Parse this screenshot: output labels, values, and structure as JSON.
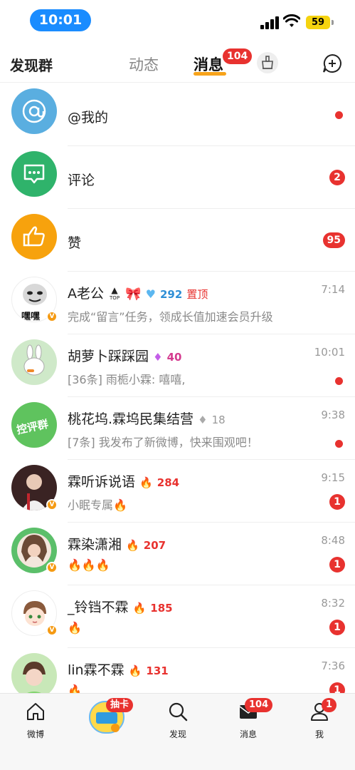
{
  "status_bar": {
    "time": "10:01",
    "battery": "59"
  },
  "header": {
    "discover_label": "发现群",
    "tab_dynamic": "动态",
    "tab_messages": "消息",
    "messages_badge": "104"
  },
  "system_rows": [
    {
      "label": "@我的",
      "icon": "at-icon",
      "color": "#5aaee0"
    },
    {
      "label": "评论",
      "icon": "comment-icon",
      "color": "#2fb36b",
      "badge": "2"
    },
    {
      "label": "赞",
      "icon": "thumbs-up-icon",
      "color": "#f7a20d",
      "badge": "95"
    }
  ],
  "conversations": [
    {
      "name": "A老公",
      "extra": "292",
      "pinned_label": "置顶",
      "avatar_text": "嘿嘿",
      "preview": "完成“留言”任务，领成长值加速会员升级",
      "time": "7:14",
      "top_tag": "TOP"
    },
    {
      "name": "胡萝卜踩踩园",
      "heat": "40",
      "preview": "[36条] 雨栀小霖: 嘻嘻,",
      "time": "10:01"
    },
    {
      "name": "桃花坞.霖坞民集结营",
      "heat": "18",
      "avatar_text": "控评群",
      "preview": "[7条] 我发布了新微博，快来围观吧！",
      "time": "9:38"
    },
    {
      "name": "霖听诉说语",
      "heat": "284",
      "preview": "小眠专属🔥",
      "time": "9:15",
      "badge": "1"
    },
    {
      "name": "霖染潇湘",
      "heat": "207",
      "preview": "🔥🔥🔥",
      "time": "8:48",
      "badge": "1"
    },
    {
      "name": "_铃铛不霖",
      "heat": "185",
      "preview": "🔥",
      "time": "8:32",
      "badge": "1"
    },
    {
      "name": "lin霖不霖",
      "heat": "131",
      "preview": "🔥",
      "time": "7:36",
      "badge": "1"
    }
  ],
  "bottom_nav": {
    "weibo": "微博",
    "lottery_badge": "抽卡",
    "discover": "发现",
    "messages": "消息",
    "messages_badge": "104",
    "me": "我",
    "me_badge": "1"
  }
}
